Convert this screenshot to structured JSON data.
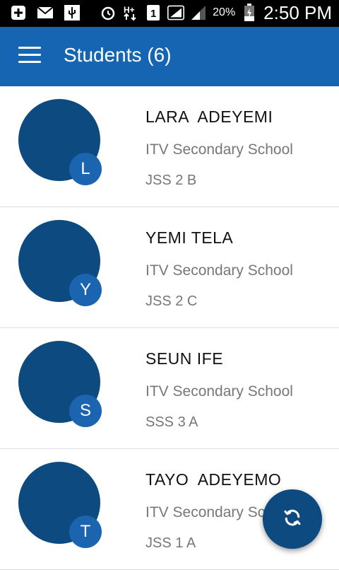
{
  "status_bar": {
    "icons_left": [
      "add-box-icon",
      "mail-icon",
      "usb-icon"
    ],
    "icons_right": [
      "alarm-icon",
      "data-transfer-icon",
      "sim-1-icon",
      "signal-full-icon",
      "signal-partial-icon",
      "battery-charging-icon"
    ],
    "battery": "20%",
    "time": "2:50 PM"
  },
  "app_bar": {
    "title": "Students (6)",
    "menu_icon": "hamburger-menu-icon",
    "color": "#1565b3"
  },
  "students": [
    {
      "initial": "L",
      "name": "LARA  ADEYEMI",
      "school": "ITV Secondary School",
      "class": "JSS 2 B"
    },
    {
      "initial": "Y",
      "name": "YEMI TELA",
      "school": "ITV Secondary School",
      "class": "JSS 2 C"
    },
    {
      "initial": "S",
      "name": "SEUN IFE",
      "school": "ITV Secondary School",
      "class": "SSS 3 A"
    },
    {
      "initial": "T",
      "name": "TAYO  ADEYEMO",
      "school": "ITV Secondary School",
      "class": "JSS 1 A"
    }
  ],
  "fab": {
    "icon": "refresh-icon",
    "color": "#0d4a80"
  },
  "colors": {
    "avatar": "#0d4a80",
    "badge": "#1a64b0"
  }
}
